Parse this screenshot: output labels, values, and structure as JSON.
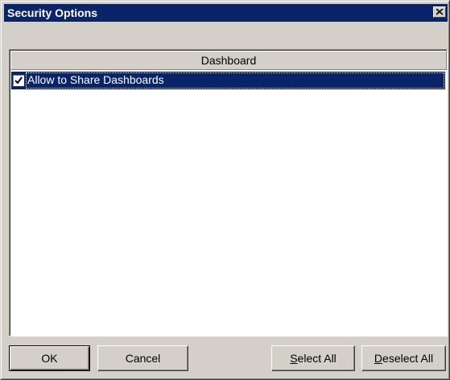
{
  "window": {
    "title": "Security Options",
    "close_icon": "close-icon"
  },
  "list": {
    "column_header": "Dashboard",
    "items": [
      {
        "label": "Allow to Share Dashboards",
        "checked": true,
        "selected": true
      }
    ]
  },
  "buttons": {
    "ok": "OK",
    "cancel": "Cancel",
    "select_all_mnemonic": "S",
    "select_all_rest": "elect All",
    "deselect_all_mnemonic": "D",
    "deselect_all_rest": "eselect All"
  },
  "colors": {
    "title_bar": "#0a246a",
    "selection": "#0a246a",
    "face": "#d4d0c8"
  }
}
